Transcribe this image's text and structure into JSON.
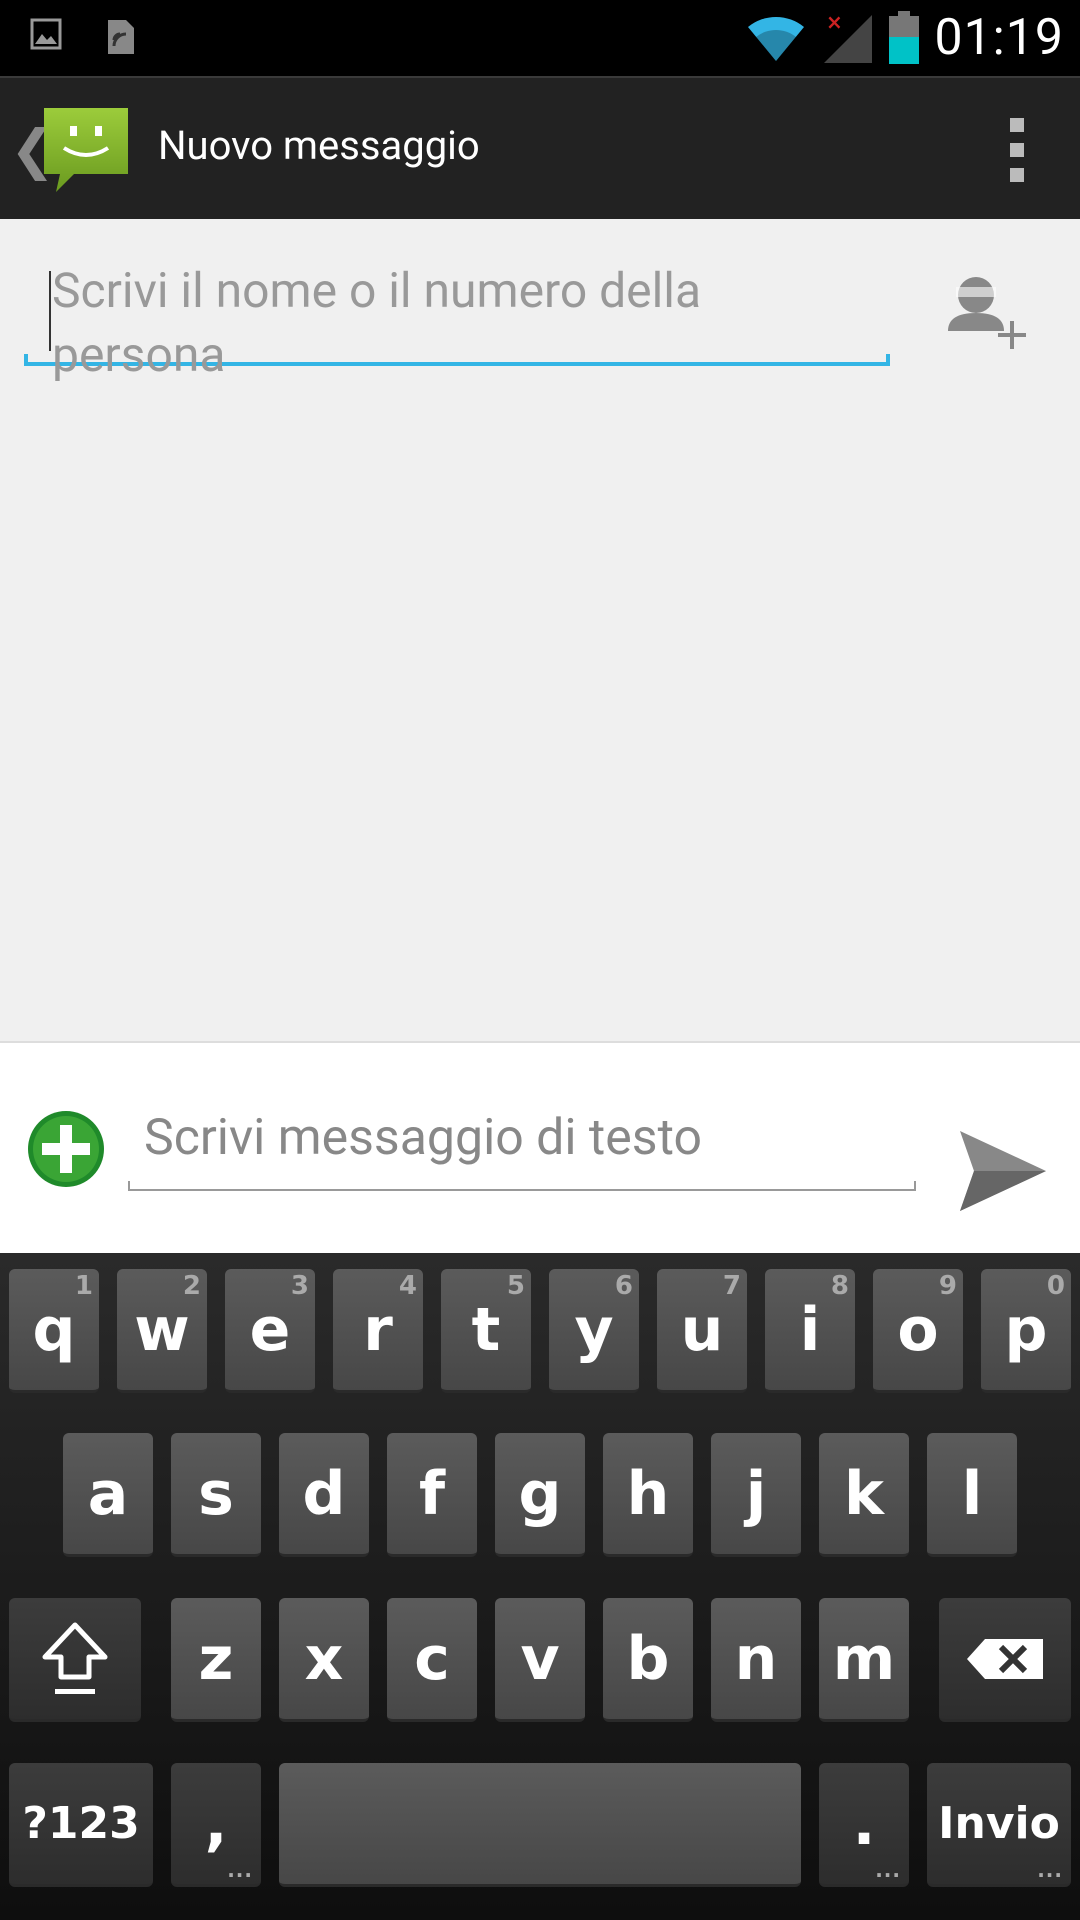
{
  "status_bar": {
    "time": "01:19",
    "icons": [
      "image-icon",
      "sim-card-icon",
      "wifi-icon",
      "signal-icon",
      "battery-icon"
    ]
  },
  "action_bar": {
    "title": "Nuovo messaggio"
  },
  "recipient": {
    "placeholder": "Scrivi il nome o il numero della persona"
  },
  "compose": {
    "placeholder": "Scrivi messaggio di testo"
  },
  "keyboard": {
    "row1": [
      {
        "label": "q",
        "hint": "1"
      },
      {
        "label": "w",
        "hint": "2"
      },
      {
        "label": "e",
        "hint": "3"
      },
      {
        "label": "r",
        "hint": "4"
      },
      {
        "label": "t",
        "hint": "5"
      },
      {
        "label": "y",
        "hint": "6"
      },
      {
        "label": "u",
        "hint": "7"
      },
      {
        "label": "i",
        "hint": "8"
      },
      {
        "label": "o",
        "hint": "9"
      },
      {
        "label": "p",
        "hint": "0"
      }
    ],
    "row2": [
      "a",
      "s",
      "d",
      "f",
      "g",
      "h",
      "j",
      "k",
      "l"
    ],
    "row3": [
      "z",
      "x",
      "c",
      "v",
      "b",
      "n",
      "m"
    ],
    "symbols_label": "?123",
    "comma_label": ",",
    "period_label": ".",
    "enter_label": "Invio",
    "more_dots": "..."
  },
  "colors": {
    "accent": "#33b5e5",
    "app_green": "#7cb342",
    "attach_green": "#3aa535"
  }
}
